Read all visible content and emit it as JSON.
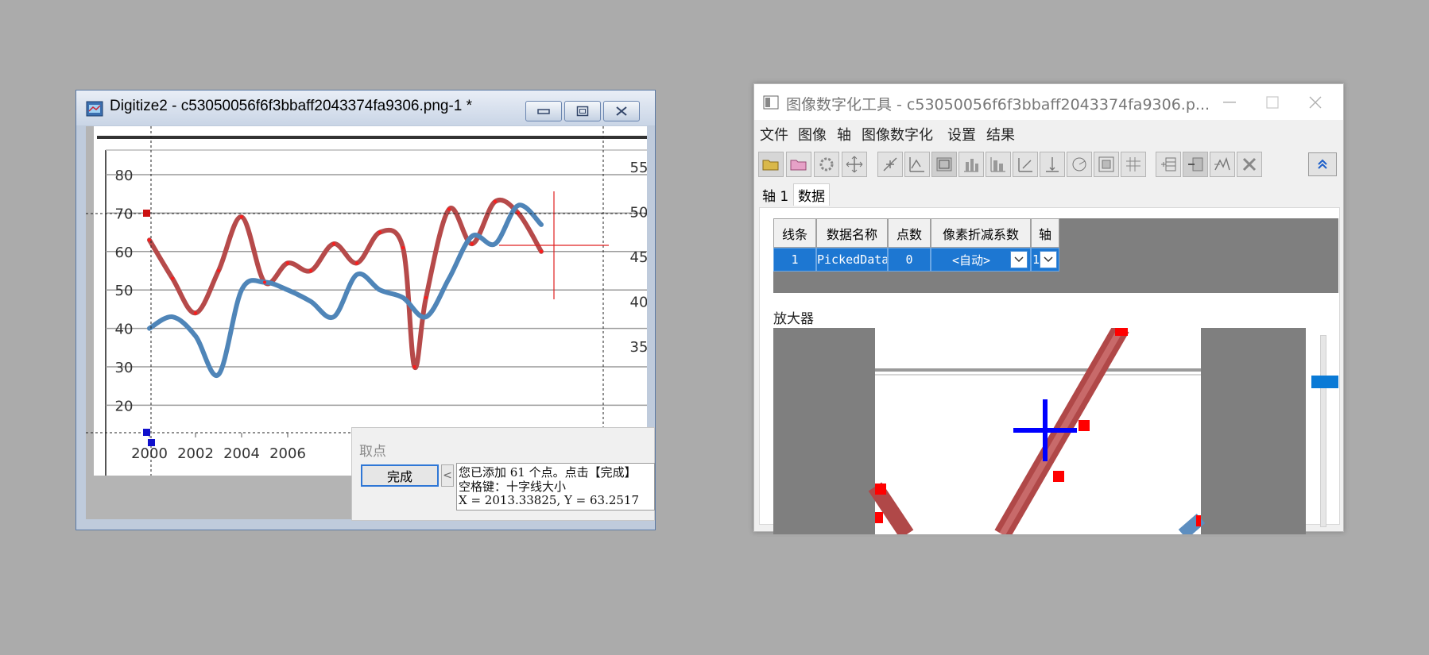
{
  "left_window": {
    "title": "Digitize2 - c53050056f6f3bbaff2043374fa9306.png-1 *"
  },
  "chart_data": {
    "type": "line",
    "title": "",
    "xlabel": "",
    "ylabel": "",
    "x_ticks": [
      "2000",
      "2002",
      "2004",
      "2006"
    ],
    "y_ticks": [
      "80",
      "70",
      "60",
      "50",
      "40",
      "30",
      "20"
    ],
    "y_right_ticks": [
      "55",
      "50",
      "45",
      "40",
      "35"
    ],
    "ylim": [
      20,
      80
    ],
    "grid": true,
    "series": [
      {
        "color": "#b64a4a",
        "x": [
          2000,
          2001,
          2002,
          2003,
          2004,
          2005,
          2006,
          2007,
          2008,
          2009,
          2010,
          2011,
          2011.5,
          2012,
          2013,
          2014,
          2015,
          2016,
          2017
        ],
        "y": [
          63,
          53,
          44,
          55,
          69,
          52,
          57,
          55,
          62,
          57,
          65,
          61,
          30,
          48,
          71,
          62,
          73,
          70,
          60
        ]
      },
      {
        "color": "#4f85b8",
        "x": [
          2000,
          2001,
          2002,
          2003,
          2004,
          2005,
          2006,
          2007,
          2008,
          2009,
          2010,
          2011,
          2012,
          2013,
          2014,
          2015,
          2016,
          2017
        ],
        "y": [
          40,
          43,
          38,
          28,
          50,
          52,
          50,
          47,
          43,
          54,
          50,
          48,
          43,
          53,
          64,
          62,
          72,
          67
        ]
      }
    ]
  },
  "pick_dialog": {
    "title": "取点",
    "done_label": "完成",
    "arrow_label": "<",
    "message_line1": "您已添加 61 个点。点击【完成】",
    "message_line2": "空格键：十字线大小",
    "message_line3": "X = 2013.33825, Y = 63.2517"
  },
  "right_window": {
    "title": "图像数字化工具 - c53050056f6f3bbaff2043374fa9306.p...",
    "menu": [
      "文件",
      "图像",
      "轴",
      "图像数字化",
      "设置",
      "结果"
    ],
    "tabs": [
      "轴 1",
      "数据"
    ],
    "table": {
      "headers": [
        "线条",
        "数据名称",
        "点数",
        "像素折减系数",
        "轴"
      ],
      "row": [
        "1",
        "PickedData",
        "0",
        "<自动>",
        "1"
      ]
    },
    "magnifier_label": "放大器"
  },
  "colors": {
    "desktop": "#ababab",
    "accent": "#1d77d2",
    "red_curve": "#b64a4a",
    "blue_curve": "#4f85b8"
  }
}
